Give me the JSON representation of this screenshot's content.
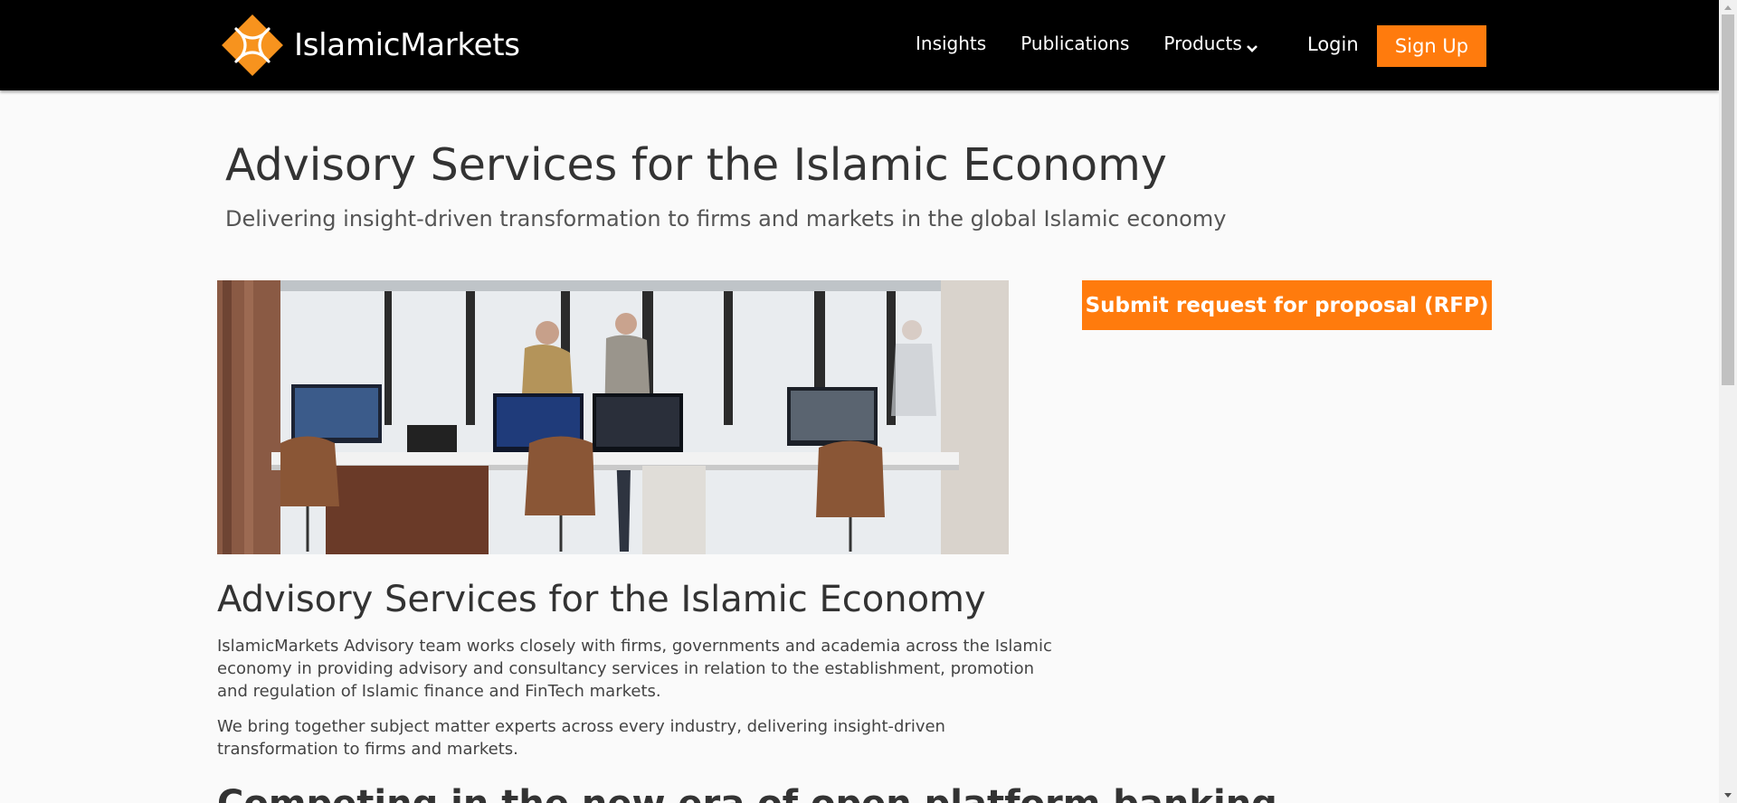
{
  "header": {
    "logo_text": "IslamicMarkets",
    "nav": [
      {
        "label": "Insights"
      },
      {
        "label": "Publications"
      },
      {
        "label": "Products"
      }
    ],
    "login_label": "Login",
    "signup_label": "Sign Up"
  },
  "hero": {
    "title": "Advisory Services for the Islamic Economy",
    "subtitle": "Delivering insight-driven transformation to firms and markets in the global Islamic economy"
  },
  "sidebar": {
    "rfp_label": "Submit request for proposal (RFP)"
  },
  "content": {
    "section_title": "Advisory Services for the Islamic Economy",
    "paragraph_1": "IslamicMarkets Advisory team works closely with firms, governments and academia across the Islamic economy in providing advisory and consultancy services in relation to the establishment, promotion and regulation of Islamic finance and FinTech markets.",
    "paragraph_2": "We bring together subject matter experts across every industry, delivering insight-driven transformation to firms and markets.",
    "next_heading": "Competing in the new era of open platform banking"
  },
  "colors": {
    "accent": "#ff7b0d",
    "header_bg": "#000000"
  },
  "icons": {
    "logo": "islamicmarkets-logo-icon",
    "products_dropdown": "chevron-down-icon"
  }
}
